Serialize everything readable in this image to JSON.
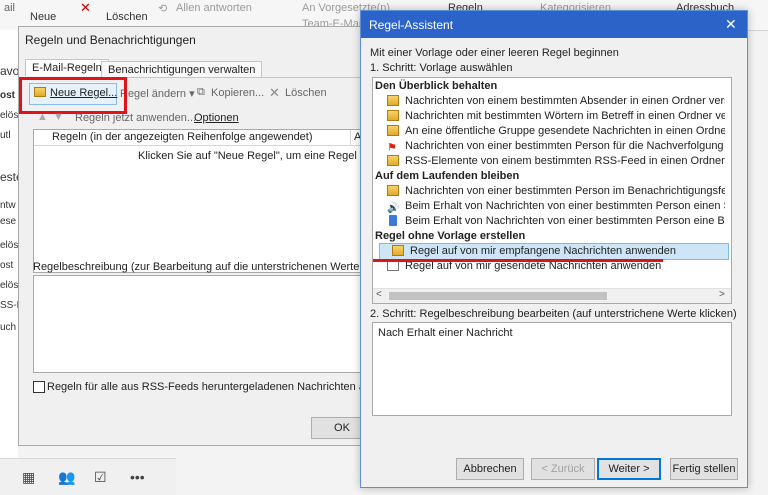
{
  "ribbon": {
    "neue": "Neue",
    "loeschen": "Löschen",
    "allen_antworten": "Allen antworten",
    "an_vorgesetzte": "An Vorgesetzte(n)",
    "regeln": "Regeln",
    "kategorisieren": "Kategorisieren",
    "adressbuch": "Adressbuch",
    "team": "Team-E-Mail",
    "mail": "ail"
  },
  "left_strip": [
    "avo",
    "ost",
    "elös",
    "utl",
    "este",
    "ntw",
    "ese",
    "elös",
    "ost",
    "elös",
    "SS-F",
    "uch"
  ],
  "rules_dialog": {
    "title": "Regeln und Benachrichtigungen",
    "tab_email": "E-Mail-Regeln",
    "tab_notify": "Benachrichtigungen verwalten",
    "new_rule": "Neue Regel...",
    "change_rule": "Regel ändern",
    "copy": "Kopieren...",
    "delete": "Löschen",
    "apply_now": "Regeln jetzt anwenden...",
    "options": "Optionen",
    "col_rule": "Regeln (in der angezeigten Reihenfolge angewendet)",
    "col_a": "Al",
    "empty_hint": "Klicken Sie auf \"Neue Regel\", um eine Regel zu er",
    "desc_label": "Regelbeschreibung (zur Bearbeitung auf die unterstrichenen Werte klick",
    "rss_check": "Regeln für alle aus RSS-Feeds heruntergeladenen Nachrichten aktivie",
    "ok": "OK"
  },
  "wizard": {
    "title": "Regel-Assistent",
    "close": "✕",
    "intro": "Mit einer Vorlage oder einer leeren Regel beginnen",
    "step1": "1. Schritt: Vorlage auswählen",
    "groups": [
      {
        "header": "Den Überblick behalten",
        "items": [
          "Nachrichten von einem bestimmten Absender in einen Ordner verschieb",
          "Nachrichten mit bestimmten Wörtern im Betreff in einen Ordner verschie",
          "An eine öffentliche Gruppe gesendete Nachrichten in einen Ordner vers",
          "Nachrichten von einer bestimmten Person für die Nachverfolgung kennz",
          "RSS-Elemente von einem bestimmten RSS-Feed in einen Ordner verschie"
        ]
      },
      {
        "header": "Auf dem Laufenden bleiben",
        "items": [
          "Nachrichten von einer bestimmten Person im Benachrichtigungsfenster",
          "Beim Erhalt von Nachrichten von einer bestimmten Person einen Sound",
          "Beim Erhalt von Nachrichten von einer bestimmten Person eine Benachr"
        ]
      },
      {
        "header": "Regel ohne Vorlage erstellen",
        "items": [
          "Regel auf von mir empfangene Nachrichten anwenden",
          "Regel auf von mir gesendete Nachrichten anwenden"
        ]
      }
    ],
    "step2": "2. Schritt: Regelbeschreibung bearbeiten (auf unterstrichene Werte klicken)",
    "description": "Nach Erhalt einer Nachricht",
    "btn_cancel": "Abbrechen",
    "btn_back": "< Zurück",
    "btn_next": "Weiter >",
    "btn_finish": "Fertig stellen"
  },
  "colors": {
    "highlight_red": "#e0131a",
    "title_blue": "#2c63c9",
    "selection": "#cde6f7"
  }
}
